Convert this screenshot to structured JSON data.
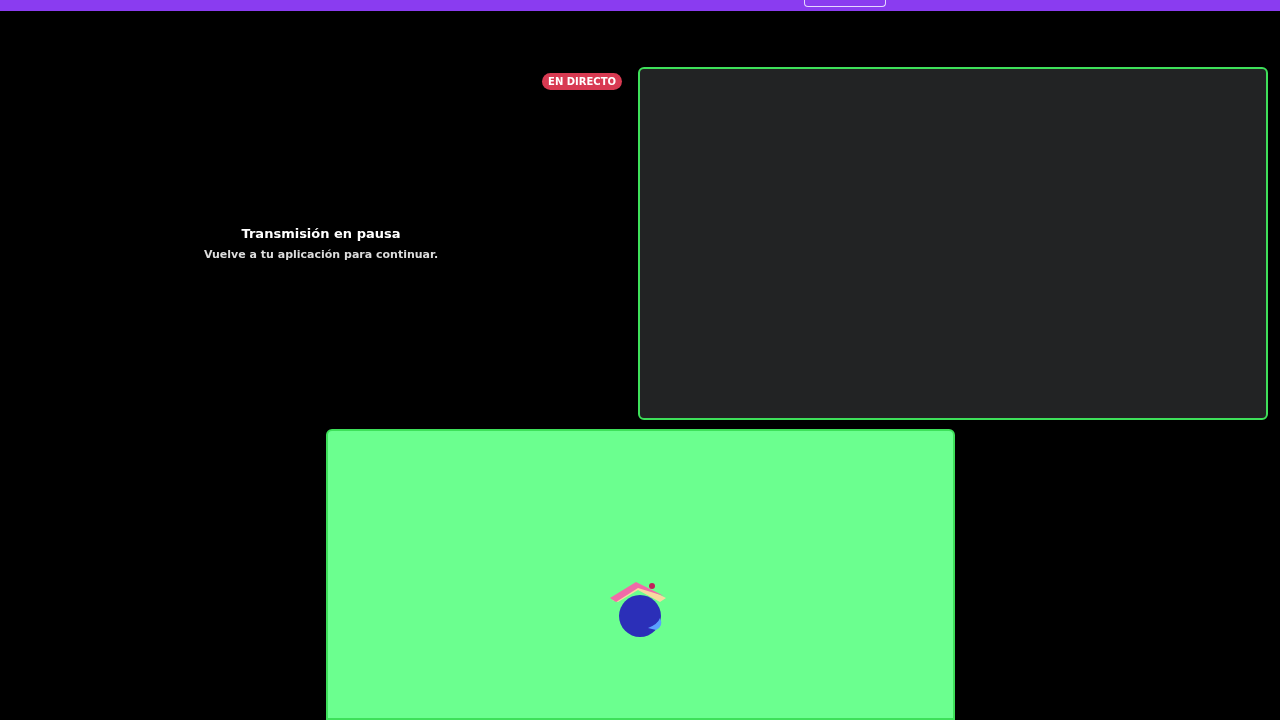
{
  "tiles": [
    {
      "kind": "stream",
      "speaking": false,
      "badge": "EN DIRECTO",
      "title": "Transmisión en pausa",
      "message": "Vuelve a tu aplicación para continuar."
    },
    {
      "kind": "camera",
      "speaking": true
    },
    {
      "kind": "avatar",
      "speaking": true
    }
  ]
}
